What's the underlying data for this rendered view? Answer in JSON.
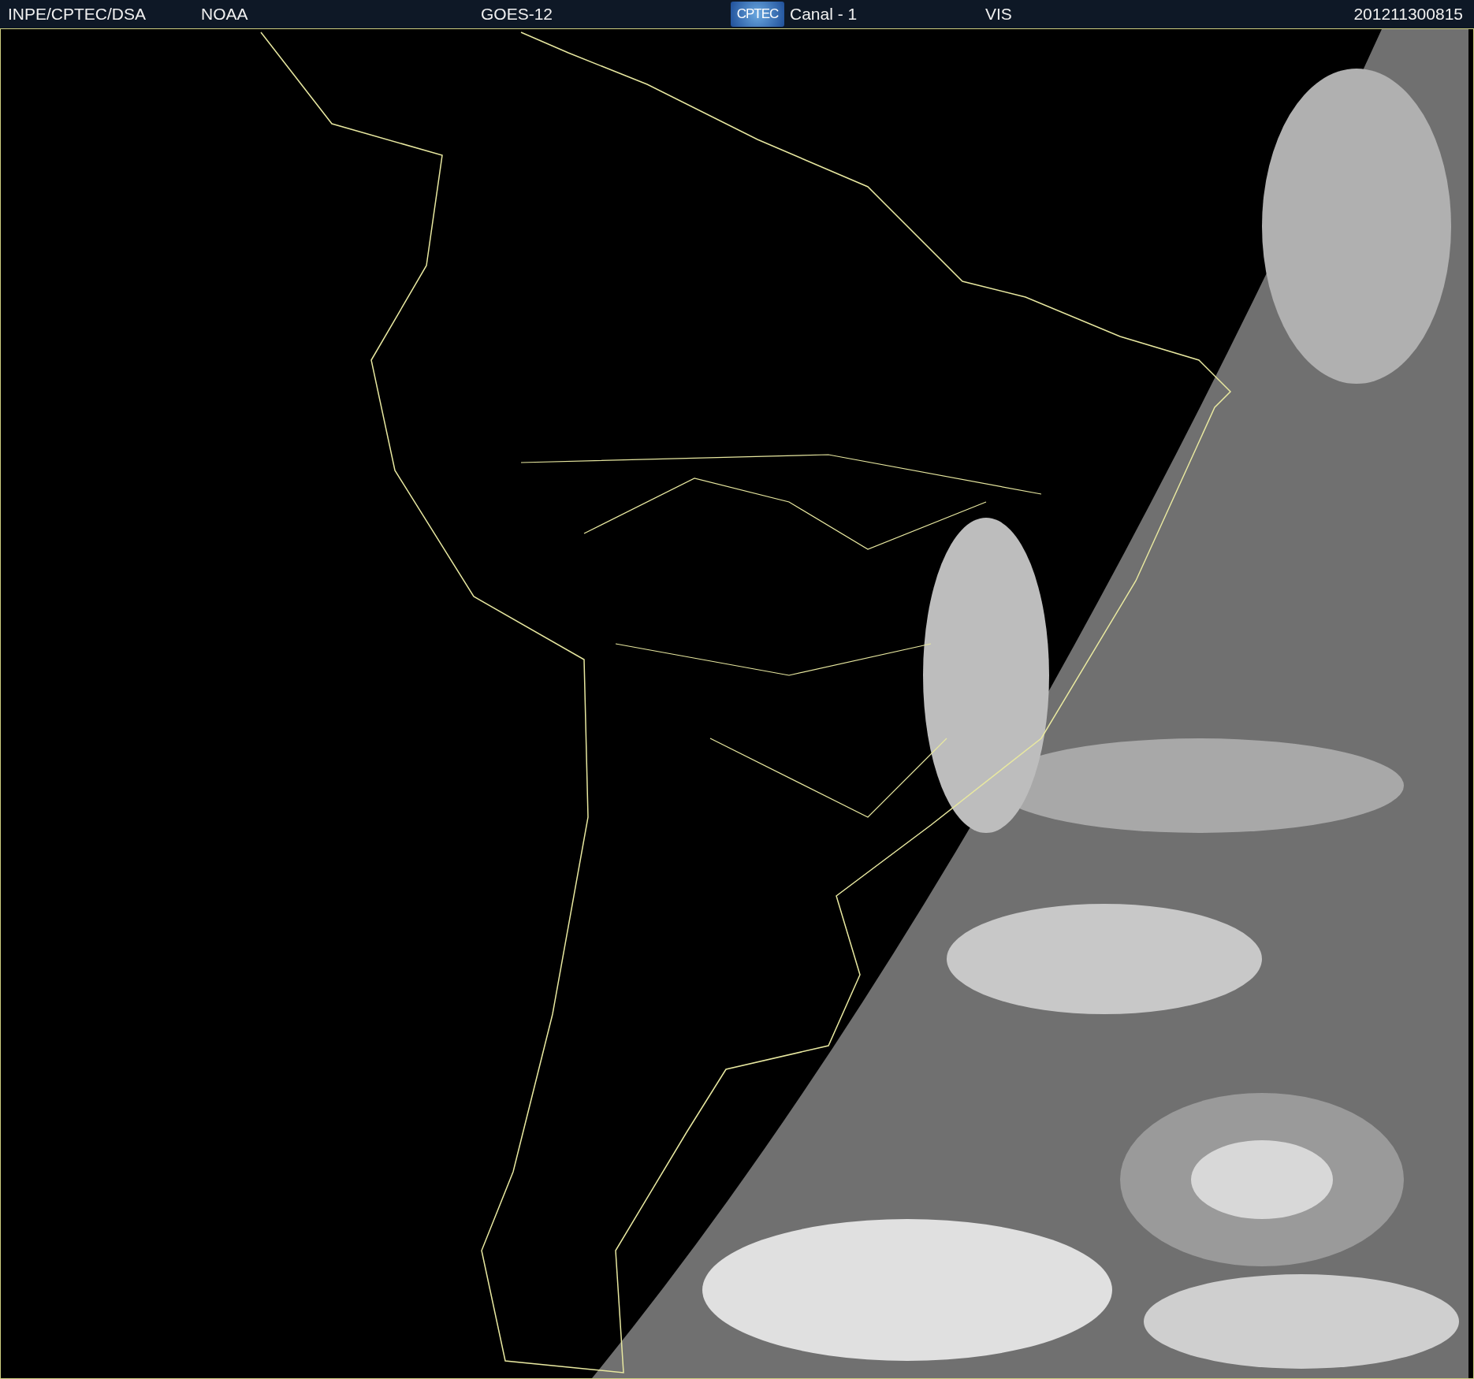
{
  "header": {
    "agency": "INPE/CPTEC/DSA",
    "source": "NOAA",
    "satellite": "GOES-12",
    "logo_text": "CPTEC",
    "channel": "Canal - 1",
    "band": "VIS",
    "timestamp": "201211300815"
  }
}
